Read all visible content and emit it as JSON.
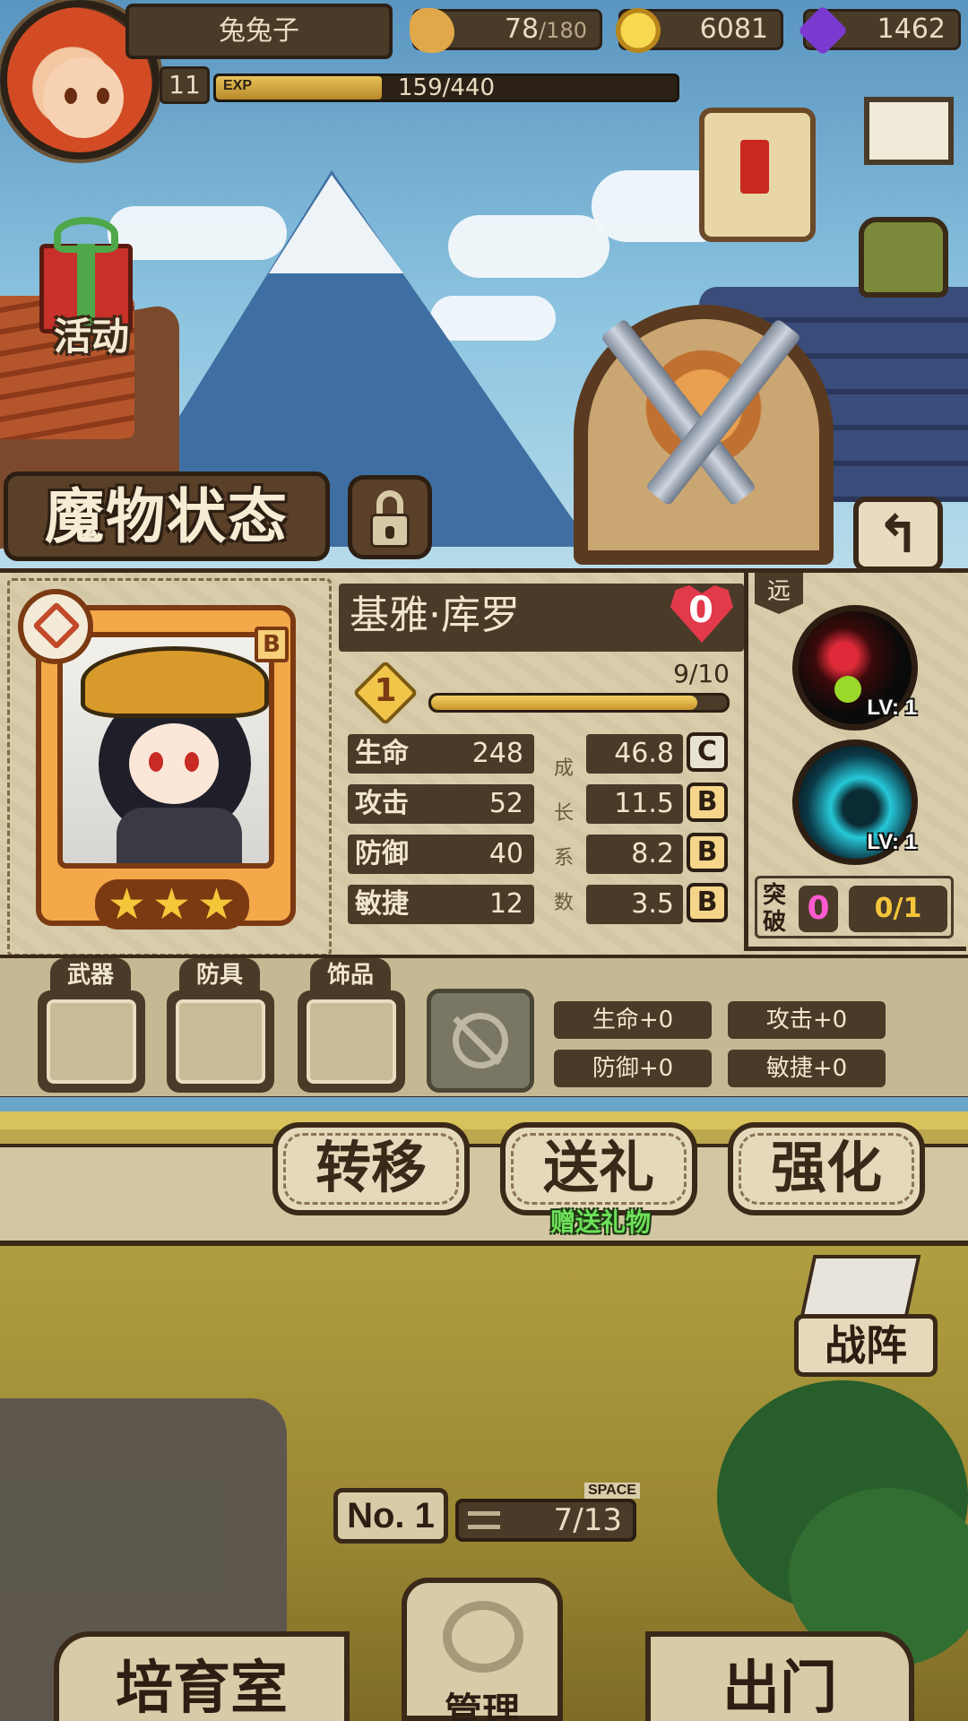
{
  "player": {
    "name": "兔兔子",
    "level": "11",
    "exp_label": "EXP",
    "exp_text": "159/440",
    "exp_fraction": 0.36
  },
  "resources": {
    "food": {
      "value": "78",
      "max": "/180",
      "icon": "bread-icon",
      "color": "#e0a848"
    },
    "gold": {
      "value": "6081",
      "icon": "gold-coin-icon",
      "color": "#e8b830"
    },
    "gems": {
      "value": "1462",
      "icon": "purple-crystal-icon",
      "color": "#7a3ad0"
    }
  },
  "event_button": {
    "label": "活动"
  },
  "screen_title": "魔物状态",
  "monster": {
    "name": "基雅·库罗",
    "rank": "B",
    "affection": "0",
    "evolution_level": "1",
    "progress_text": "9/10",
    "progress_fraction": 0.9,
    "stars": 3,
    "range_tag": "远",
    "stats": [
      {
        "name": "生命",
        "value": "248",
        "growth": "46.8",
        "grade": "C"
      },
      {
        "name": "攻击",
        "value": "52",
        "growth": "11.5",
        "grade": "B"
      },
      {
        "name": "防御",
        "value": "40",
        "growth": "8.2",
        "grade": "B"
      },
      {
        "name": "敏捷",
        "value": "12",
        "growth": "3.5",
        "grade": "B"
      }
    ],
    "growth_label": [
      "成",
      "长",
      "系",
      "数"
    ],
    "skills": [
      {
        "level": "LV: 1",
        "icon": "red-green-orb-skill-icon"
      },
      {
        "level": "LV: 1",
        "icon": "cyan-swirl-skill-icon"
      }
    ],
    "breakthrough": {
      "label": "突破",
      "count": "0",
      "progress": "0/1"
    }
  },
  "equipment": {
    "slots": [
      {
        "label": "武器"
      },
      {
        "label": "防具"
      },
      {
        "label": "饰品"
      }
    ],
    "bonuses": [
      "生命+0",
      "攻击+0",
      "防御+0",
      "敏捷+0"
    ]
  },
  "actions": {
    "transfer": "转移",
    "gift": "送礼",
    "gift_sub": "赠送礼物",
    "enhance": "强化"
  },
  "scene_hud": {
    "team": "战阵",
    "number_label": "No. 1",
    "space_tag": "SPACE",
    "space_value": "7/13"
  },
  "nav": {
    "nursery": "培育室",
    "manage": "管理",
    "go_out": "出门"
  },
  "colors": {
    "panel_bg": "#d8ccab",
    "dark_wood": "#4a3a28",
    "card_orange": "#f3a84a",
    "heart_red": "#e23a4a",
    "break_pink": "#ff5ad0",
    "gift_green": "#6ee05a"
  }
}
